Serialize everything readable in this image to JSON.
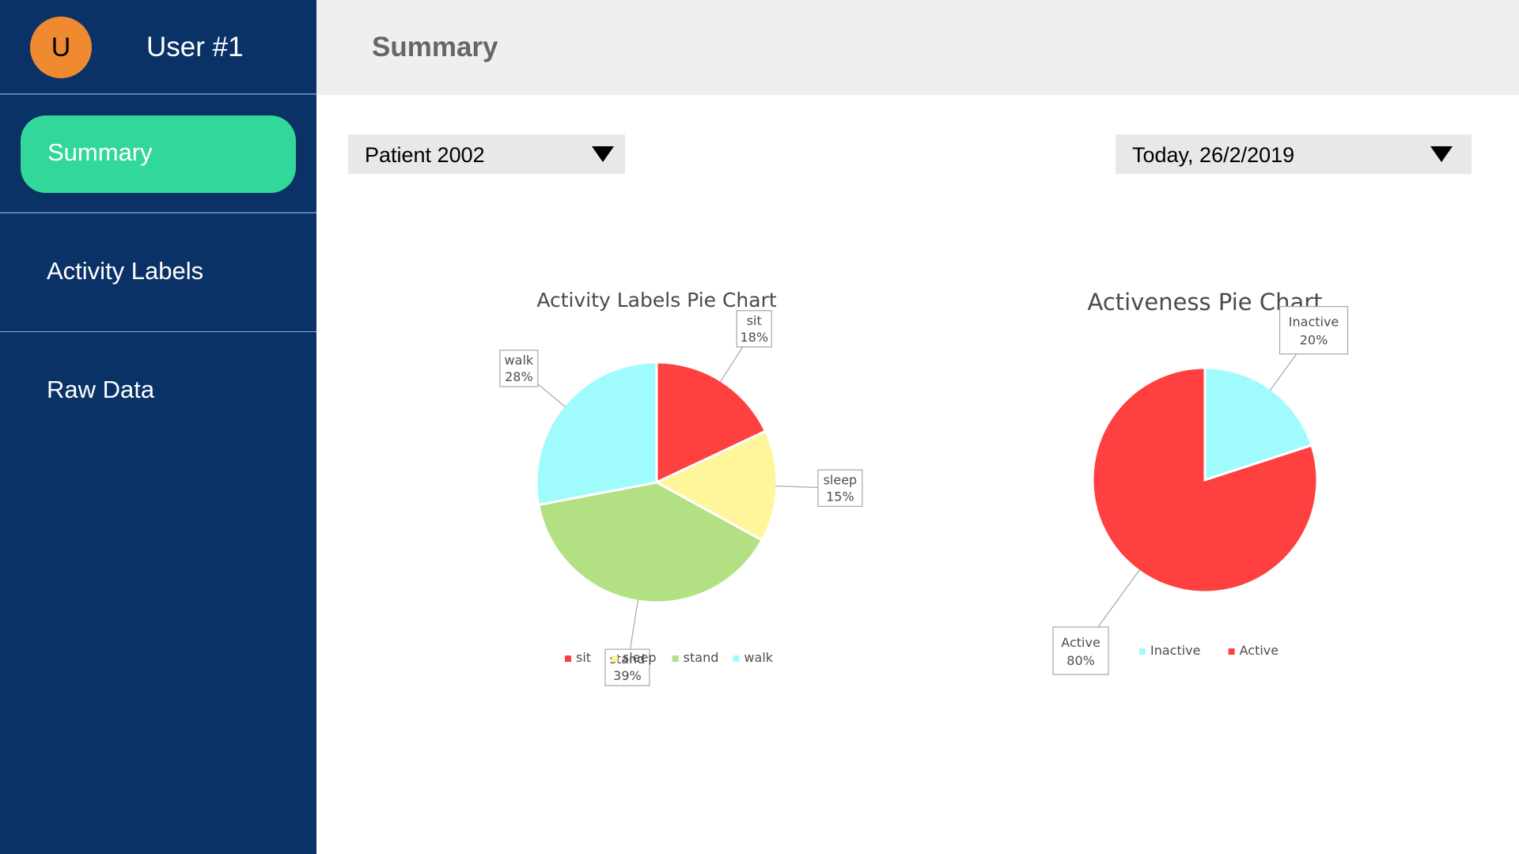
{
  "user": {
    "avatar_initial": "U",
    "name": "User #1"
  },
  "sidebar": {
    "items": [
      {
        "label": "Summary",
        "active": true
      },
      {
        "label": "Activity Labels",
        "active": false
      },
      {
        "label": "Raw Data",
        "active": false
      }
    ]
  },
  "header": {
    "title": "Summary"
  },
  "filters": {
    "patient": "Patient 2002",
    "date": "Today, 26/2/2019"
  },
  "icons": {
    "patient_dropdown": "triangle-down-icon",
    "date_dropdown": "triangle-down-icon"
  },
  "colors": {
    "sidebar_bg": "#0b3266",
    "active_pill": "#31d89a",
    "avatar": "#f08a30"
  },
  "chart_data": [
    {
      "type": "pie",
      "title": "Activity Labels Pie Chart",
      "categories": [
        "sit",
        "sleep",
        "stand",
        "walk"
      ],
      "values": [
        18,
        15,
        39,
        28
      ],
      "labels": [
        "18%",
        "15%",
        "39%",
        "28%"
      ],
      "colors": [
        "#ff4040",
        "#fff59a",
        "#b2e082",
        "#a0fbfd"
      ],
      "legend": "bottom"
    },
    {
      "type": "pie",
      "title": "Activeness Pie Chart",
      "categories": [
        "Inactive",
        "Active"
      ],
      "values": [
        20,
        80
      ],
      "labels": [
        "20%",
        "80%"
      ],
      "colors": [
        "#a0fbfd",
        "#ff4040"
      ],
      "legend": "bottom"
    }
  ]
}
